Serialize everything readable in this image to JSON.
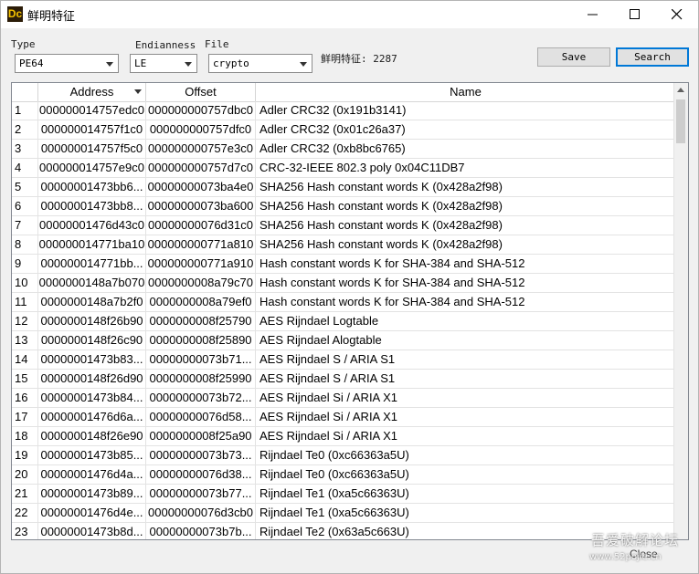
{
  "window": {
    "title": "鲜明特征",
    "app_icon": "Dc"
  },
  "toolbar": {
    "type_label": "Type",
    "type_value": "PE64",
    "endianness_label": "Endianness",
    "endianness_value": "LE",
    "file_label": "File",
    "file_value": "crypto",
    "count_text": "鲜明特征: 2287",
    "save_label": "Save",
    "search_label": "Search"
  },
  "table": {
    "columns": [
      "",
      "Address",
      "Offset",
      "Name"
    ],
    "rows": [
      {
        "num": "1",
        "address": "000000014757edc0",
        "offset": "000000000757dbc0",
        "name": "Adler CRC32 (0x191b3141)"
      },
      {
        "num": "2",
        "address": "000000014757f1c0",
        "offset": "000000000757dfc0",
        "name": "Adler CRC32 (0x01c26a37)"
      },
      {
        "num": "3",
        "address": "000000014757f5c0",
        "offset": "000000000757e3c0",
        "name": "Adler CRC32 (0xb8bc6765)"
      },
      {
        "num": "4",
        "address": "000000014757e9c0",
        "offset": "000000000757d7c0",
        "name": "CRC-32-IEEE 802.3 poly 0x04C11DB7"
      },
      {
        "num": "5",
        "address": "00000001473bb6...",
        "offset": "00000000073ba4e0",
        "name": "SHA256 Hash constant words K (0x428a2f98)"
      },
      {
        "num": "6",
        "address": "00000001473bb8...",
        "offset": "00000000073ba600",
        "name": "SHA256 Hash constant words K (0x428a2f98)"
      },
      {
        "num": "7",
        "address": "00000001476d43c0",
        "offset": "00000000076d31c0",
        "name": "SHA256 Hash constant words K (0x428a2f98)"
      },
      {
        "num": "8",
        "address": "000000014771ba10",
        "offset": "000000000771a810",
        "name": "SHA256 Hash constant words K (0x428a2f98)"
      },
      {
        "num": "9",
        "address": "000000014771bb...",
        "offset": "000000000771a910",
        "name": "Hash constant words K for SHA-384 and SHA-512"
      },
      {
        "num": "10",
        "address": "0000000148a7b070",
        "offset": "0000000008a79c70",
        "name": "Hash constant words K for SHA-384 and SHA-512"
      },
      {
        "num": "11",
        "address": "0000000148a7b2f0",
        "offset": "0000000008a79ef0",
        "name": "Hash constant words K for SHA-384 and SHA-512"
      },
      {
        "num": "12",
        "address": "0000000148f26b90",
        "offset": "0000000008f25790",
        "name": "AES Rijndael Logtable"
      },
      {
        "num": "13",
        "address": "0000000148f26c90",
        "offset": "0000000008f25890",
        "name": "AES Rijndael Alogtable"
      },
      {
        "num": "14",
        "address": "00000001473b83...",
        "offset": "00000000073b71...",
        "name": "AES Rijndael S / ARIA S1"
      },
      {
        "num": "15",
        "address": "0000000148f26d90",
        "offset": "0000000008f25990",
        "name": "AES Rijndael S / ARIA S1"
      },
      {
        "num": "16",
        "address": "00000001473b84...",
        "offset": "00000000073b72...",
        "name": "AES Rijndael Si / ARIA X1"
      },
      {
        "num": "17",
        "address": "00000001476d6a...",
        "offset": "00000000076d58...",
        "name": "AES Rijndael Si / ARIA X1"
      },
      {
        "num": "18",
        "address": "0000000148f26e90",
        "offset": "0000000008f25a90",
        "name": "AES Rijndael Si / ARIA X1"
      },
      {
        "num": "19",
        "address": "00000001473b85...",
        "offset": "00000000073b73...",
        "name": "Rijndael Te0 (0xc66363a5U)"
      },
      {
        "num": "20",
        "address": "00000001476d4a...",
        "offset": "00000000076d38...",
        "name": "Rijndael Te0 (0xc66363a5U)"
      },
      {
        "num": "21",
        "address": "00000001473b89...",
        "offset": "00000000073b77...",
        "name": "Rijndael Te1 (0xa5c66363U)"
      },
      {
        "num": "22",
        "address": "00000001476d4e...",
        "offset": "00000000076d3cb0",
        "name": "Rijndael Te1 (0xa5c66363U)"
      },
      {
        "num": "23",
        "address": "00000001473b8d...",
        "offset": "00000000073b7b...",
        "name": "Rijndael Te2 (0x63a5c663U)"
      }
    ]
  },
  "footer": {
    "close_label": "Close"
  },
  "watermark": {
    "line1": "吾爱破解论坛",
    "line2": "www.52pojie.cn"
  },
  "colors": {
    "focus_border": "#0078d7",
    "app_icon_bg": "#2b1c08",
    "app_icon_fg": "#f5c200"
  }
}
